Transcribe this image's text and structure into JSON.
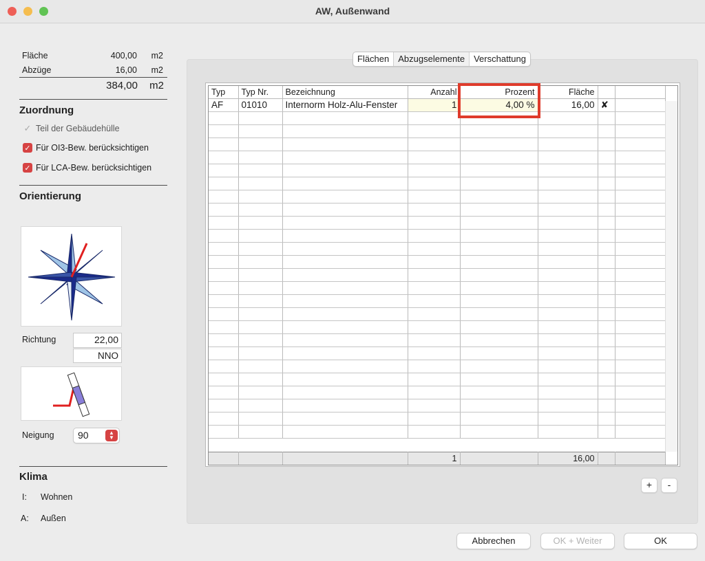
{
  "window": {
    "title": "AW, Außenwand"
  },
  "summary": {
    "flaeche_label": "Fläche",
    "flaeche_value": "400,00",
    "flaeche_unit": "m2",
    "abzuege_label": "Abzüge",
    "abzuege_value": "16,00",
    "abzuege_unit": "m2",
    "total_value": "384,00",
    "total_unit": "m2"
  },
  "zuordnung": {
    "heading": "Zuordnung",
    "items": [
      {
        "label": "Teil der Gebäudehülle",
        "checked": true,
        "disabled": true
      },
      {
        "label": "Für OI3-Bew. berücksichtigen",
        "checked": true,
        "disabled": false
      },
      {
        "label": "Für LCA-Bew. berücksichtigen",
        "checked": true,
        "disabled": false
      }
    ]
  },
  "orientierung": {
    "heading": "Orientierung",
    "richtung_label": "Richtung",
    "richtung_value": "22,00",
    "richtung_direction": "NNO",
    "neigung_label": "Neigung",
    "neigung_value": "90"
  },
  "klima": {
    "heading": "Klima",
    "inner_key": "I:",
    "inner_value": "Wohnen",
    "outer_key": "A:",
    "outer_value": "Außen"
  },
  "tabs": [
    {
      "label": "Flächen",
      "active": false
    },
    {
      "label": "Abzugselemente",
      "active": true
    },
    {
      "label": "Verschattung",
      "active": false
    }
  ],
  "table": {
    "columns": [
      "Typ",
      "Typ Nr.",
      "Bezeichnung",
      "Anzahl",
      "Prozent",
      "Fläche",
      ""
    ],
    "rows": [
      {
        "typ": "AF",
        "typ_nr": "01010",
        "bezeichnung": "Internorm Holz-Alu-Fenster",
        "anzahl": "1",
        "prozent": "4,00 %",
        "flaeche": "16,00",
        "delete": "✘"
      }
    ],
    "totals": {
      "anzahl": "1",
      "flaeche": "16,00"
    }
  },
  "row_buttons": {
    "add": "+",
    "remove": "-"
  },
  "buttons": {
    "cancel": "Abbrechen",
    "ok_next": "OK + Weiter",
    "ok": "OK"
  },
  "colors": {
    "accent": "#d64343",
    "highlight_box": "#df3b2b",
    "cell_highlight": "#fcfbe3"
  }
}
